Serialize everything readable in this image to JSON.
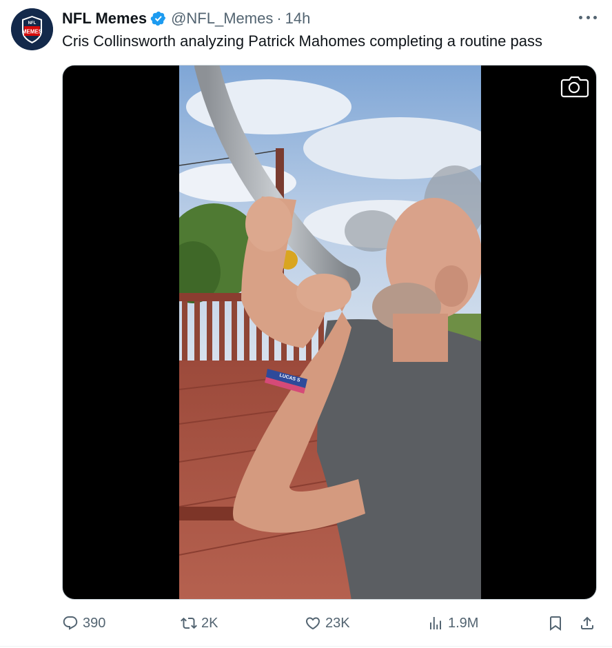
{
  "tweet": {
    "author": {
      "display_name": "NFL Memes",
      "handle": "@NFL_Memes",
      "verified": true,
      "avatar_text_top": "NFL",
      "avatar_text_main": "MEMES"
    },
    "separator": "·",
    "time": "14h",
    "text": "Cris Collinsworth analyzing Patrick Mahomes completing a routine pass",
    "media": {
      "wristband_text": "LUCAS S",
      "overlay_icon": "camera-icon"
    },
    "actions": {
      "replies": "390",
      "retweets": "2K",
      "likes": "23K",
      "views": "1.9M"
    }
  },
  "colors": {
    "text_primary": "#0f1419",
    "text_secondary": "#536471",
    "verified_blue": "#1d9bf0",
    "avatar_navy": "#13294b",
    "avatar_red": "#d50a0a"
  },
  "icons": [
    "more-icon",
    "verified-icon",
    "camera-icon",
    "reply-icon",
    "retweet-icon",
    "like-icon",
    "views-icon",
    "bookmark-icon",
    "share-icon"
  ]
}
